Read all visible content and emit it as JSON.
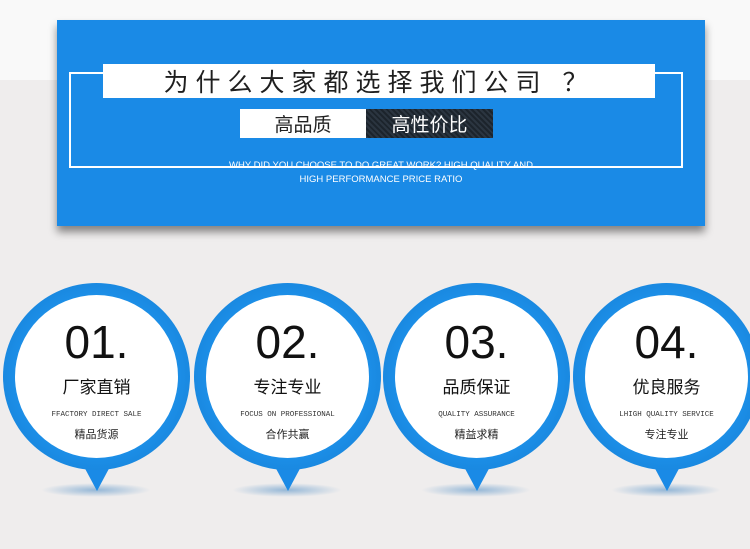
{
  "banner": {
    "headline": "为什么大家都选择我们公司 ？",
    "tags": [
      "高品质",
      "高性价比"
    ],
    "subtitle_lines": [
      "WHY DID YOU CHOOSE TO DO GREAT WORK? HIGH QUALITY AND",
      "HIGH PERFORMANCE PRICE RATIO"
    ]
  },
  "features": [
    {
      "number": "01.",
      "title": "厂家直销",
      "english": "FFACTORY DIRECT SALE",
      "subtitle": "精品货源"
    },
    {
      "number": "02.",
      "title": "专注专业",
      "english": "FOCUS ON PROFESSIONAL",
      "subtitle": "合作共赢"
    },
    {
      "number": "03.",
      "title": "品质保证",
      "english": "QUALITY ASSURANCE",
      "subtitle": "精益求精"
    },
    {
      "number": "04.",
      "title": "优良服务",
      "english": "LHIGH QUALITY SERVICE",
      "subtitle": "专注专业"
    }
  ],
  "colors": {
    "accent": "#1a8ae6",
    "background": "#efeded",
    "dark_tag": "#2b3540"
  }
}
